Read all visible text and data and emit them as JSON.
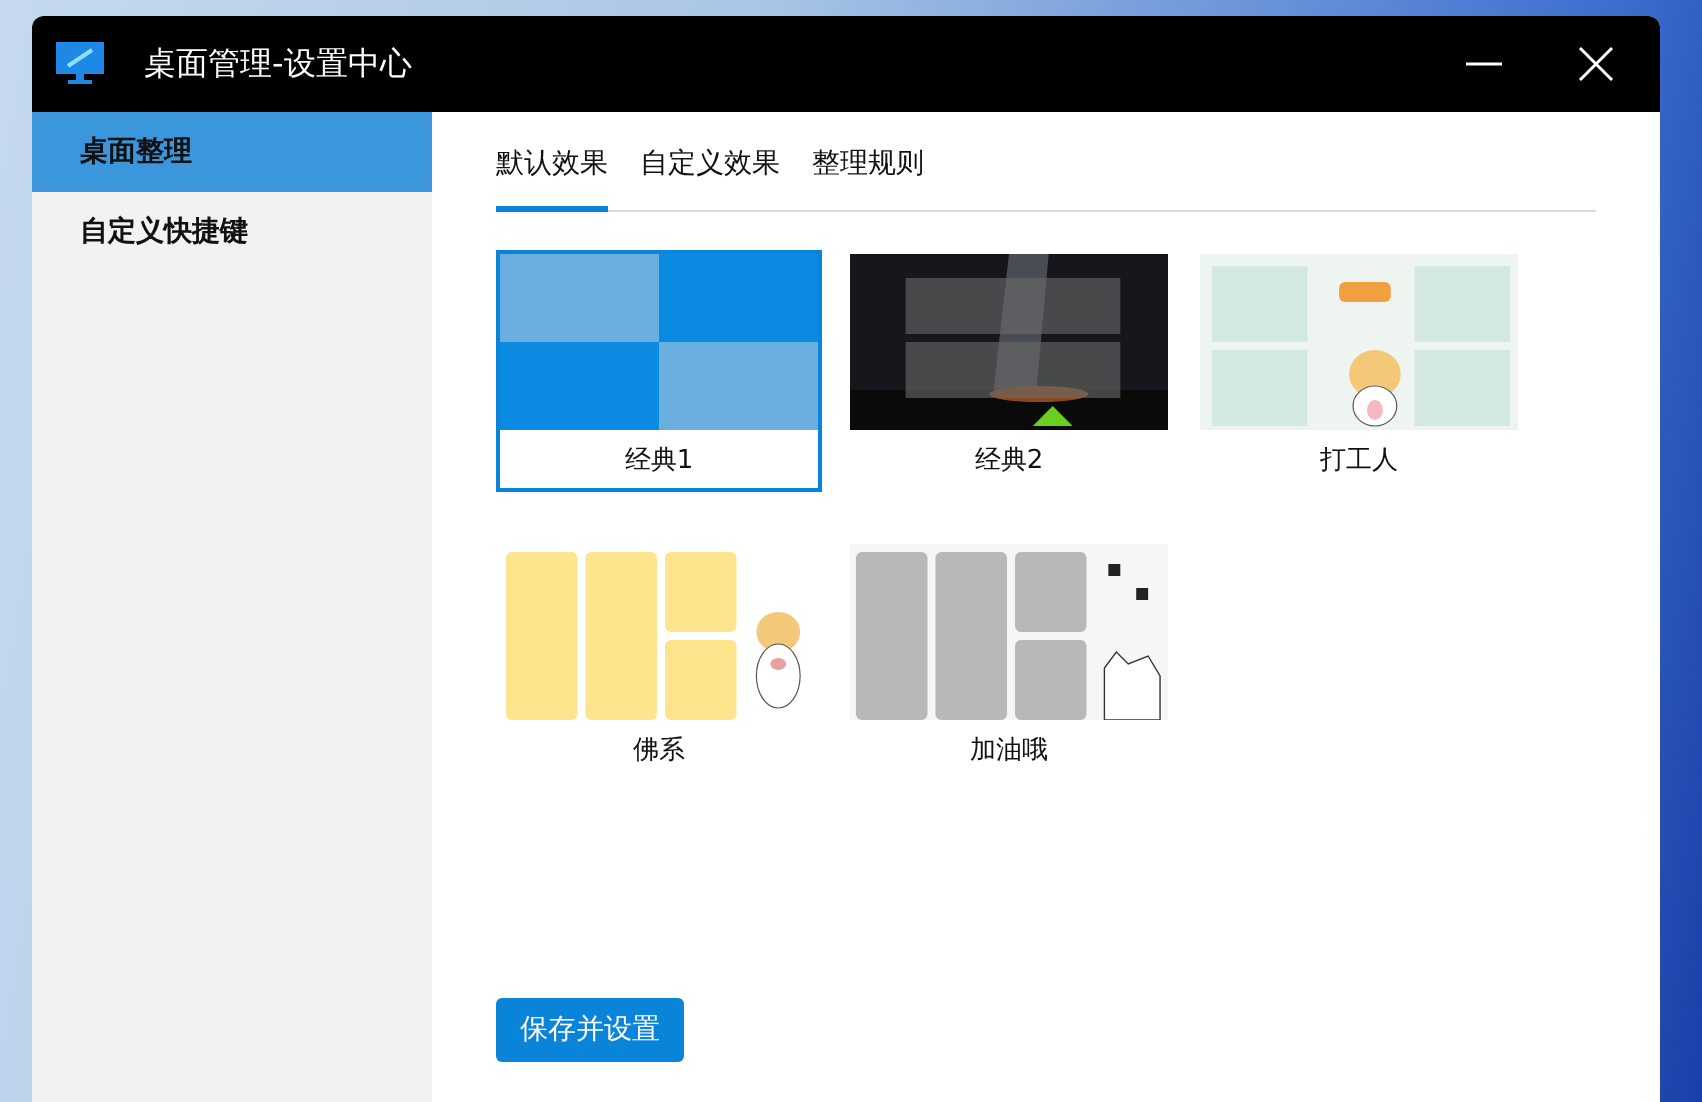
{
  "window": {
    "title": "桌面管理-设置中心"
  },
  "sidebar": {
    "items": [
      {
        "label": "桌面整理",
        "selected": true
      },
      {
        "label": "自定义快捷键",
        "selected": false
      }
    ]
  },
  "tabs": [
    {
      "label": "默认效果",
      "selected": true
    },
    {
      "label": "自定义效果",
      "selected": false
    },
    {
      "label": "整理规则",
      "selected": false
    }
  ],
  "themes": [
    {
      "label": "经典1",
      "kind": "classic",
      "selected": true
    },
    {
      "label": "经典2",
      "kind": "night",
      "selected": false
    },
    {
      "label": "打工人",
      "kind": "worker",
      "selected": false
    },
    {
      "label": "佛系",
      "kind": "calm",
      "selected": false
    },
    {
      "label": "加油哦",
      "kind": "cheer",
      "selected": false
    }
  ],
  "save_button": {
    "label": "保存并设置"
  }
}
